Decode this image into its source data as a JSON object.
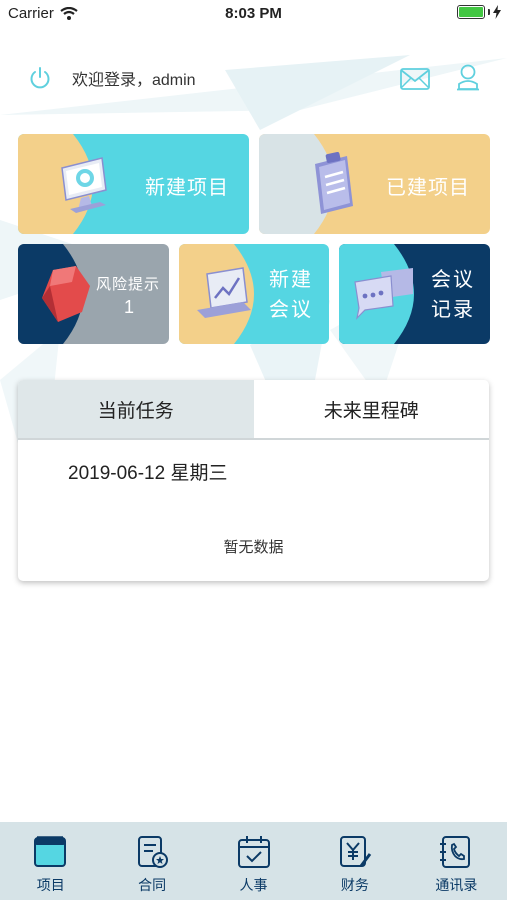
{
  "status_bar": {
    "carrier": "Carrier",
    "time": "8:03 PM",
    "battery_level": 1.0
  },
  "header": {
    "welcome": "欢迎登录，admin"
  },
  "tiles": {
    "new_project": "新建项目",
    "existing_project": "已建项目",
    "risk_alert": {
      "label": "风险提示",
      "count": "1"
    },
    "new_meeting": {
      "line1": "新建",
      "line2": "会议"
    },
    "meeting_records": {
      "line1": "会议",
      "line2": "记录"
    }
  },
  "tasks": {
    "tabs": [
      "当前任务",
      "未来里程碑"
    ],
    "active_tab": 0,
    "date": "2019-06-12 星期三",
    "empty": "暂无数据"
  },
  "nav": {
    "items": [
      {
        "label": "项目",
        "icon": "project-icon"
      },
      {
        "label": "合同",
        "icon": "contract-icon"
      },
      {
        "label": "人事",
        "icon": "calendar-icon"
      },
      {
        "label": "财务",
        "icon": "finance-icon"
      },
      {
        "label": "通讯录",
        "icon": "contacts-icon"
      }
    ]
  },
  "colors": {
    "cyan": "#55d6e2",
    "sand": "#f3d08a",
    "navy": "#0b3a66",
    "grey": "#9aa5ad",
    "icon_cyan": "#5fd0de"
  }
}
